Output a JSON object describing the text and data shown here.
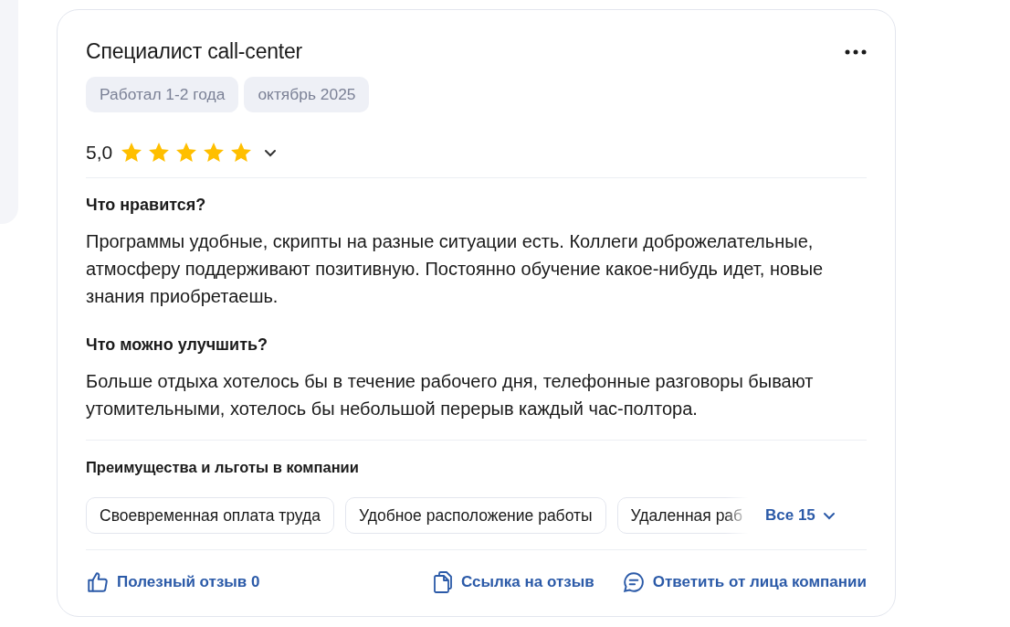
{
  "review": {
    "title": "Специалист call-center",
    "tags": [
      "Работал 1-2 года",
      "октябрь 2025"
    ],
    "rating": {
      "value": "5,0",
      "stars": 5
    },
    "sections": [
      {
        "heading": "Что нравится?",
        "text": "Программы удобные, скрипты на разные ситуации есть. Коллеги доброжелательные, атмосферу поддерживают позитивную. Постоянно обучение какое-нибудь идет, новые знания приобретаешь."
      },
      {
        "heading": "Что можно улучшить?",
        "text": "Больше отдыха хотелось бы в течение рабочего дня, телефонные разговоры бывают утомительными, хотелось бы небольшой перерыв каждый час-полтора."
      }
    ],
    "benefits": {
      "title": "Преимущества и льготы в компании",
      "items": [
        "Своевременная оплата труда",
        "Удобное расположение работы",
        "Удаленная раб"
      ],
      "more": "Все 15"
    },
    "actions": [
      {
        "kind": "like",
        "label": "Полезный отзыв 0"
      },
      {
        "kind": "link",
        "label": "Ссылка на отзыв"
      },
      {
        "kind": "reply",
        "label": "Ответить от лица компании"
      }
    ]
  }
}
